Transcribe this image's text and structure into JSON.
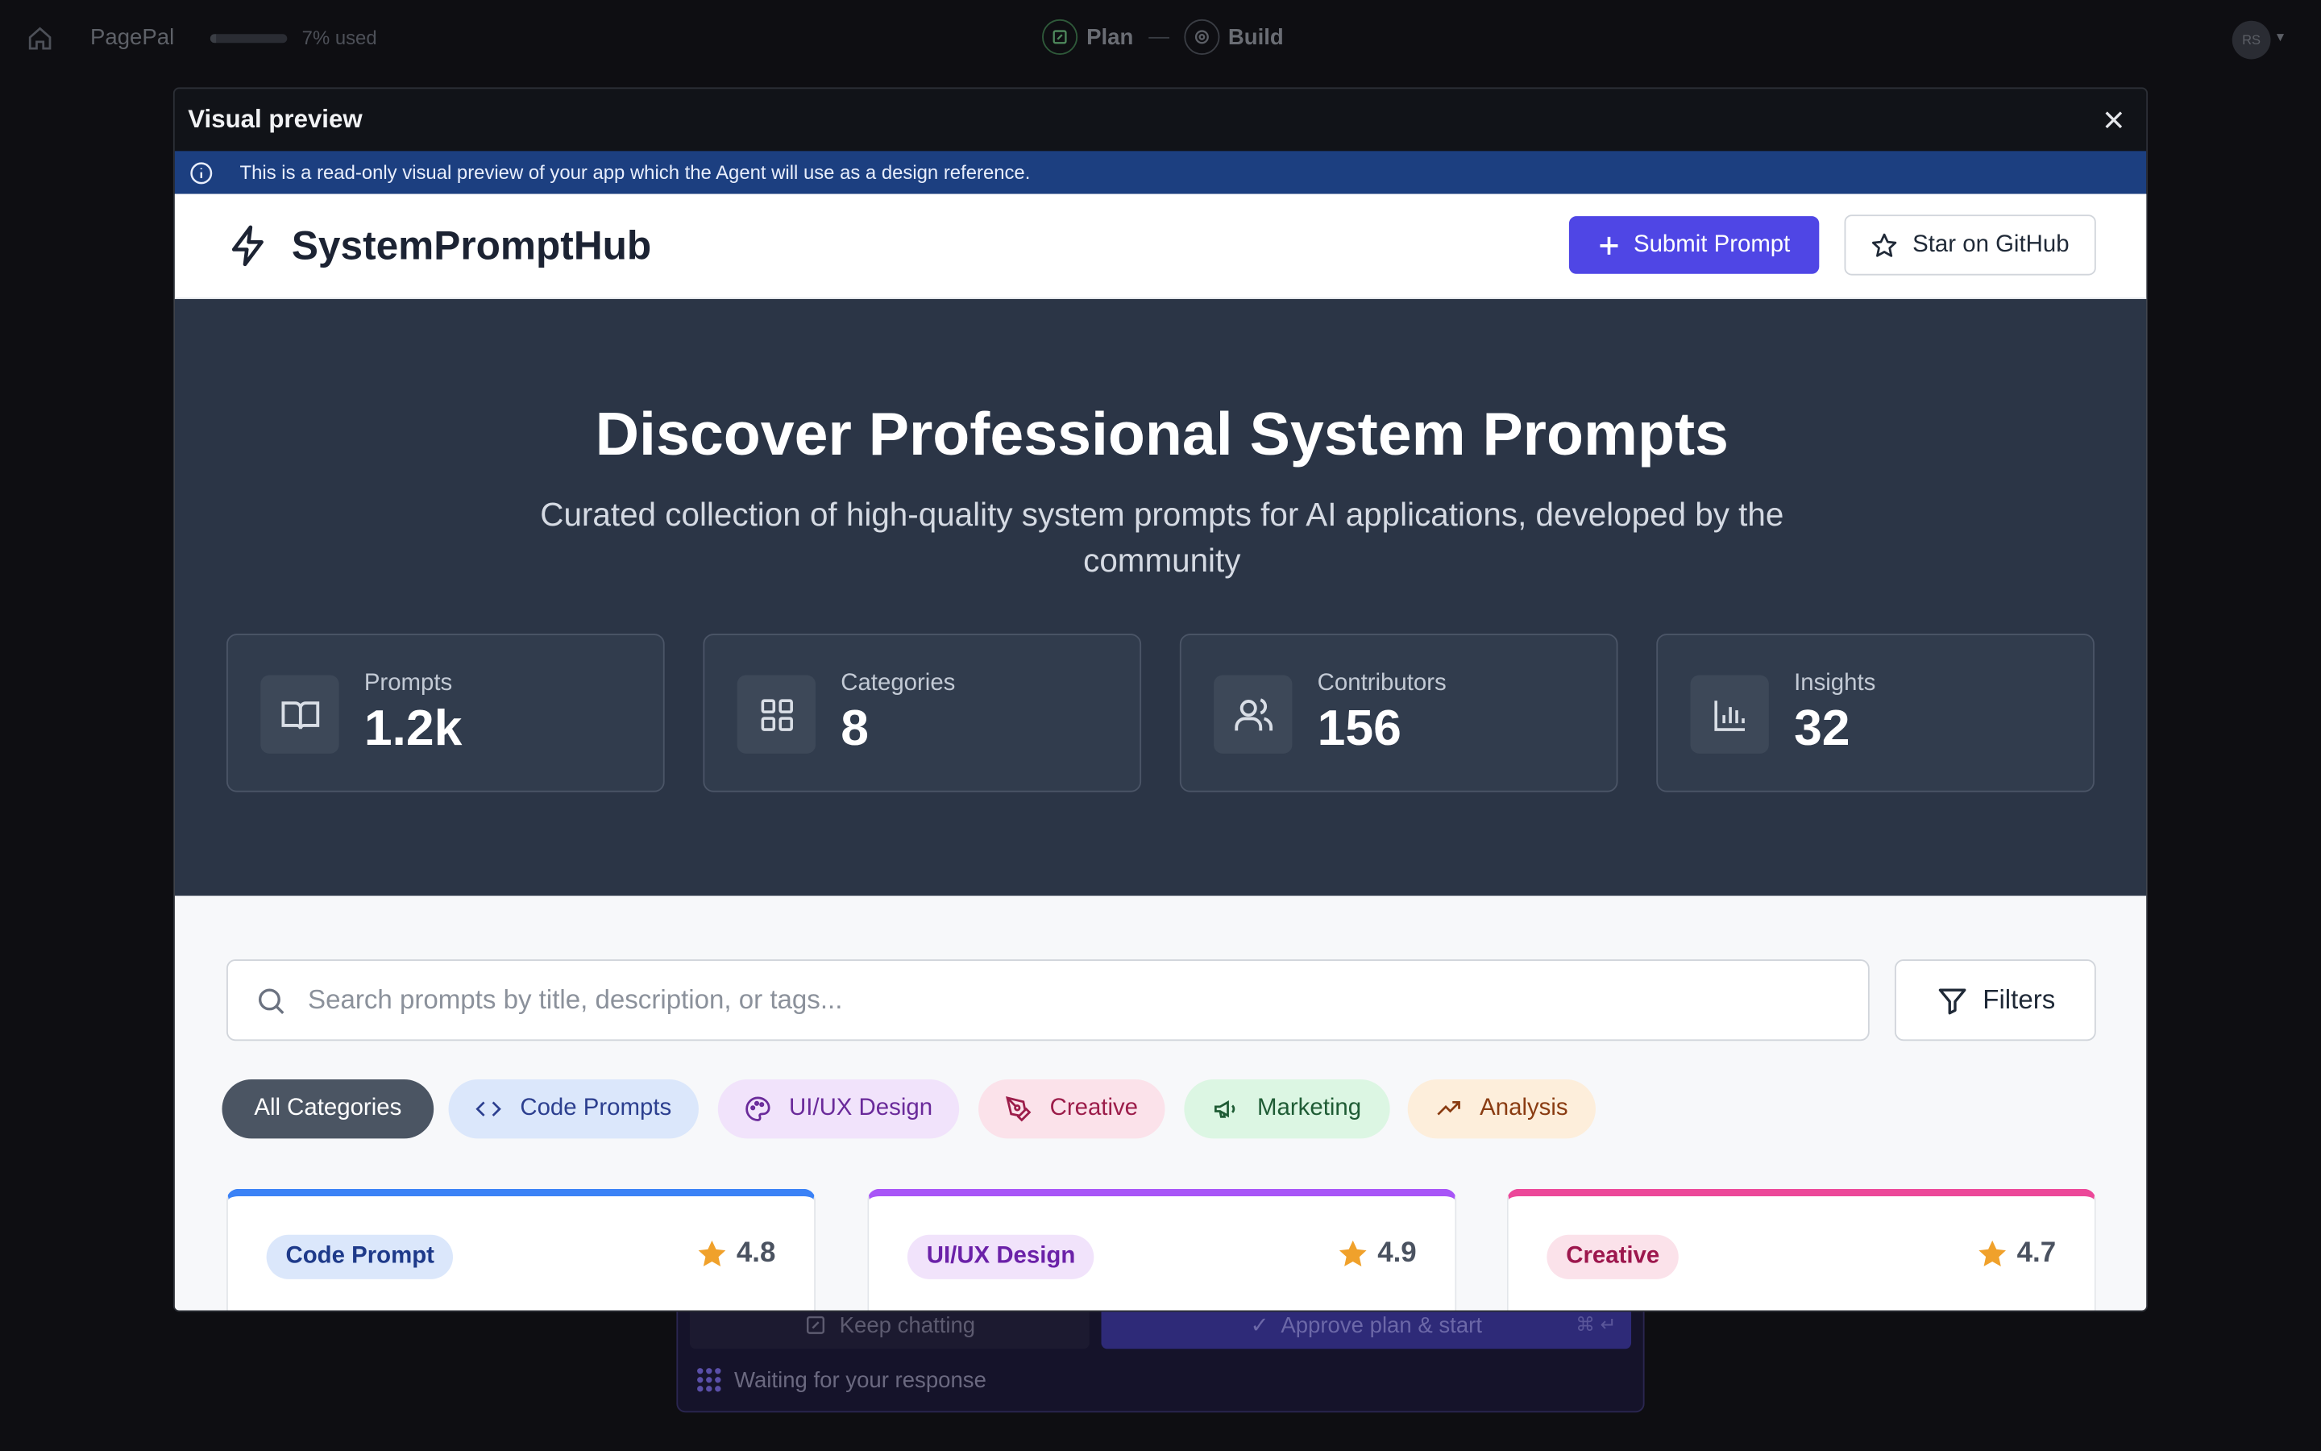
{
  "background": {
    "app_name": "PagePal",
    "usage_text": "7% used",
    "usage_percent": 7,
    "step_plan": "Plan",
    "step_build": "Build",
    "avatar_initials": "RS",
    "keep_chatting": "Keep chatting",
    "approve": "Approve plan & start",
    "approve_shortcut": "⌘ ↵",
    "waiting": "Waiting for your response"
  },
  "modal": {
    "title": "Visual preview",
    "notice": "This is a read-only visual preview of your app which the Agent will use as a design reference."
  },
  "app": {
    "brand": "SystemPromptHub",
    "submit_label": "Submit Prompt",
    "star_label": "Star on GitHub",
    "hero_title": "Discover Professional System Prompts",
    "hero_subtitle": "Curated collection of high-quality system prompts for AI applications, developed by the community",
    "stats": [
      {
        "label": "Prompts",
        "value": "1.2k",
        "icon": "book-icon"
      },
      {
        "label": "Categories",
        "value": "8",
        "icon": "grid-icon"
      },
      {
        "label": "Contributors",
        "value": "156",
        "icon": "users-icon"
      },
      {
        "label": "Insights",
        "value": "32",
        "icon": "bar-chart-icon"
      }
    ],
    "search_placeholder": "Search prompts by title, description, or tags...",
    "filters_label": "Filters",
    "categories": [
      {
        "label": "All Categories",
        "icon": "",
        "bg": "#4b5563",
        "fg": "#ffffff"
      },
      {
        "label": "Code Prompts",
        "icon": "code-icon",
        "bg": "#dbe7fb",
        "fg": "#2c3f8f"
      },
      {
        "label": "UI/UX Design",
        "icon": "palette-icon",
        "bg": "#f1e3fb",
        "fg": "#6a2a9a"
      },
      {
        "label": "Creative",
        "icon": "pen-icon",
        "bg": "#fbe2ea",
        "fg": "#9c1d4a"
      },
      {
        "label": "Marketing",
        "icon": "megaphone-icon",
        "bg": "#dcf6e3",
        "fg": "#1f5c35"
      },
      {
        "label": "Analysis",
        "icon": "trending-up-icon",
        "bg": "#fdeedb",
        "fg": "#8a3c12"
      }
    ],
    "cards": [
      {
        "tag": "Code Prompt",
        "rating": "4.8",
        "accent": "#3b82f6",
        "tag_bg": "#dbe7fb",
        "tag_fg": "#1e3a8a"
      },
      {
        "tag": "UI/UX Design",
        "rating": "4.9",
        "accent": "#a855f7",
        "tag_bg": "#f1e3fb",
        "tag_fg": "#6b21a8"
      },
      {
        "tag": "Creative",
        "rating": "4.7",
        "accent": "#ec4899",
        "tag_bg": "#fbe2ea",
        "tag_fg": "#9d174d"
      }
    ]
  }
}
